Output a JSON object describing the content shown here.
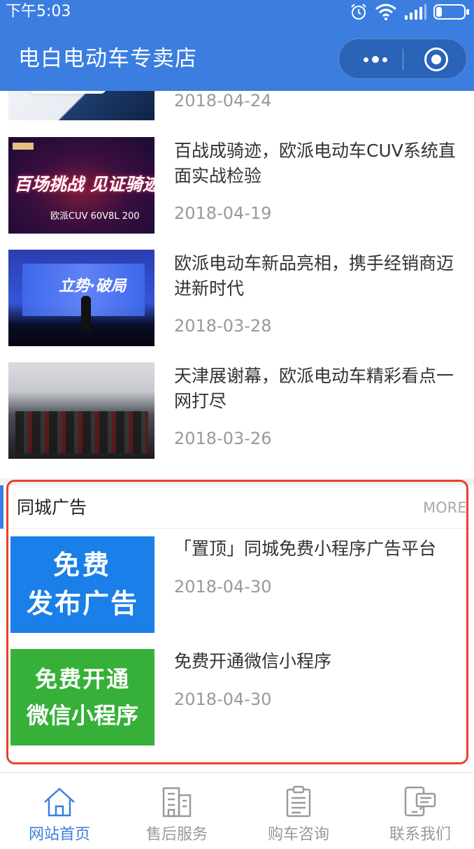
{
  "status_bar": {
    "time": "下午5:03"
  },
  "nav": {
    "title": "电白电动车专卖店"
  },
  "news": [
    {
      "title": "",
      "date": "2018-04-24"
    },
    {
      "title": "百战成骑迹，欧派电动车CUV系统直面实战检验",
      "date": "2018-04-19",
      "thumb_text": "百场挑战 见证骑迹",
      "thumb_sub": "欧派CUV 60V8L 200"
    },
    {
      "title": "欧派电动车新品亮相，携手经销商迈进新时代",
      "date": "2018-03-28",
      "thumb_text": "立势·破局"
    },
    {
      "title": "天津展谢幕，欧派电动车精彩看点一网打尽",
      "date": "2018-03-26"
    }
  ],
  "ads_section": {
    "title": "同城广告",
    "more": "MORE",
    "items": [
      {
        "title": "「置顶」同城免费小程序广告平台",
        "date": "2018-04-30",
        "thumb_line1": "免费",
        "thumb_line2": "发布广告",
        "thumb_color": "#1a7fe8"
      },
      {
        "title": "免费开通微信小程序",
        "date": "2018-04-30",
        "thumb_line1": "免费开通",
        "thumb_line2": "微信小程序",
        "thumb_color": "#37b03a"
      }
    ]
  },
  "tabbar": {
    "tabs": [
      {
        "label": "网站首页",
        "icon": "home-icon",
        "active": true
      },
      {
        "label": "售后服务",
        "icon": "building-icon",
        "active": false
      },
      {
        "label": "购车咨询",
        "icon": "clipboard-icon",
        "active": false
      },
      {
        "label": "联系我们",
        "icon": "phone-chat-icon",
        "active": false
      }
    ]
  },
  "colors": {
    "primary": "#3b7ee0",
    "highlight_border": "#e8412e",
    "date_gray": "#999999"
  }
}
